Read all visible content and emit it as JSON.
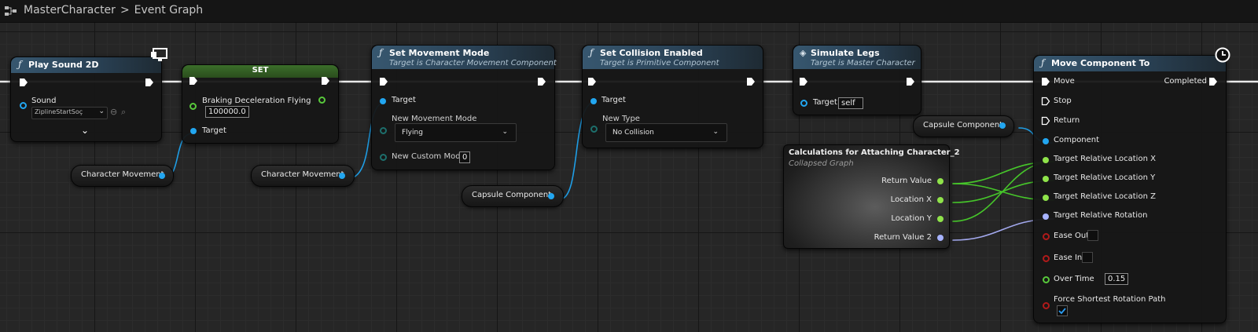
{
  "breadcrumb": {
    "blueprint": "MasterCharacter",
    "separator": ">",
    "graph": "Event Graph"
  },
  "nodes": {
    "play_sound": {
      "title": "Play Sound 2D",
      "sound_label": "Sound",
      "sound_value": "ZiplineStartSoç"
    },
    "set": {
      "title": "SET",
      "var_label": "Braking Deceleration Flying",
      "var_value": "100000.0",
      "target_label": "Target"
    },
    "set_movement": {
      "title": "Set Movement Mode",
      "subtitle": "Target is Character Movement Component",
      "target_label": "Target",
      "mode_label": "New Movement Mode",
      "mode_value": "Flying",
      "custom_label": "New Custom Mode",
      "custom_value": "0"
    },
    "set_collision": {
      "title": "Set Collision Enabled",
      "subtitle": "Target is Primitive Component",
      "target_label": "Target",
      "type_label": "New Type",
      "type_value": "No Collision"
    },
    "simulate_legs": {
      "title": "Simulate Legs",
      "subtitle": "Target is Master Character",
      "target_label": "Target",
      "target_value": "self"
    },
    "calculations": {
      "title": "Calculations for Attaching Character_2",
      "subtitle": "Collapsed Graph",
      "outputs": [
        "Return Value",
        "Location X",
        "Location Y",
        "Return Value 2"
      ]
    },
    "move_component": {
      "title": "Move Component To",
      "exec_inputs": [
        "Move",
        "Stop",
        "Return"
      ],
      "exec_output": "Completed",
      "component_label": "Component",
      "targets": [
        "Target Relative Location X",
        "Target Relative Location Y",
        "Target Relative Location Z",
        "Target Relative Rotation"
      ],
      "ease_out": "Ease Out",
      "ease_in": "Ease In",
      "over_time_label": "Over Time",
      "over_time_value": "0.15",
      "force_label": "Force Shortest Rotation Path"
    }
  },
  "variables": {
    "char_movement_1": "Character Movement",
    "char_movement_2": "Character Movement",
    "capsule_1": "Capsule Component",
    "capsule_2": "Capsule Component"
  },
  "colors": {
    "exec": "#ffffff",
    "object": "#22a6f0",
    "float": "#8fe34a",
    "rotator": "#a7b3ff",
    "header": "#37576f"
  }
}
